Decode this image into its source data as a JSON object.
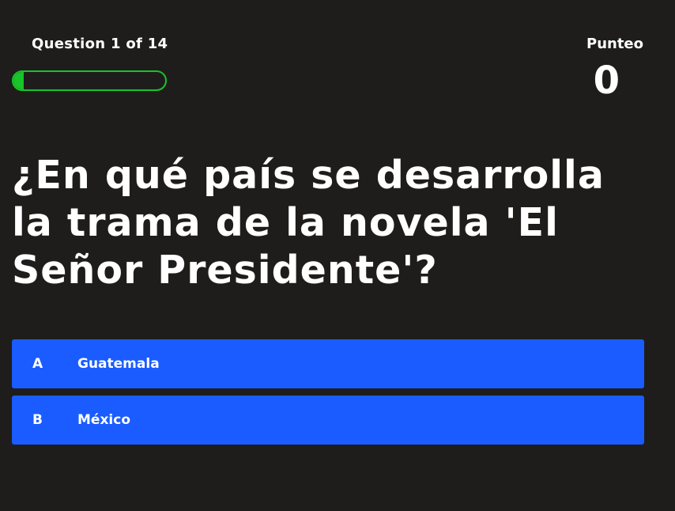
{
  "header": {
    "question_counter": "Question 1 of 14",
    "progress_fraction": 0.07,
    "progress_color": "#19c32a",
    "score_label": "Punteo",
    "score_value": "0"
  },
  "question": {
    "text": "¿En qué país se desarrolla la trama de la novela 'El Señor Presidente'?"
  },
  "answers": [
    {
      "letter": "A",
      "text": "Guatemala"
    },
    {
      "letter": "B",
      "text": "México"
    }
  ],
  "colors": {
    "background": "#1e1d1c",
    "answer_bg": "#1a5cff",
    "text": "#ffffff"
  }
}
